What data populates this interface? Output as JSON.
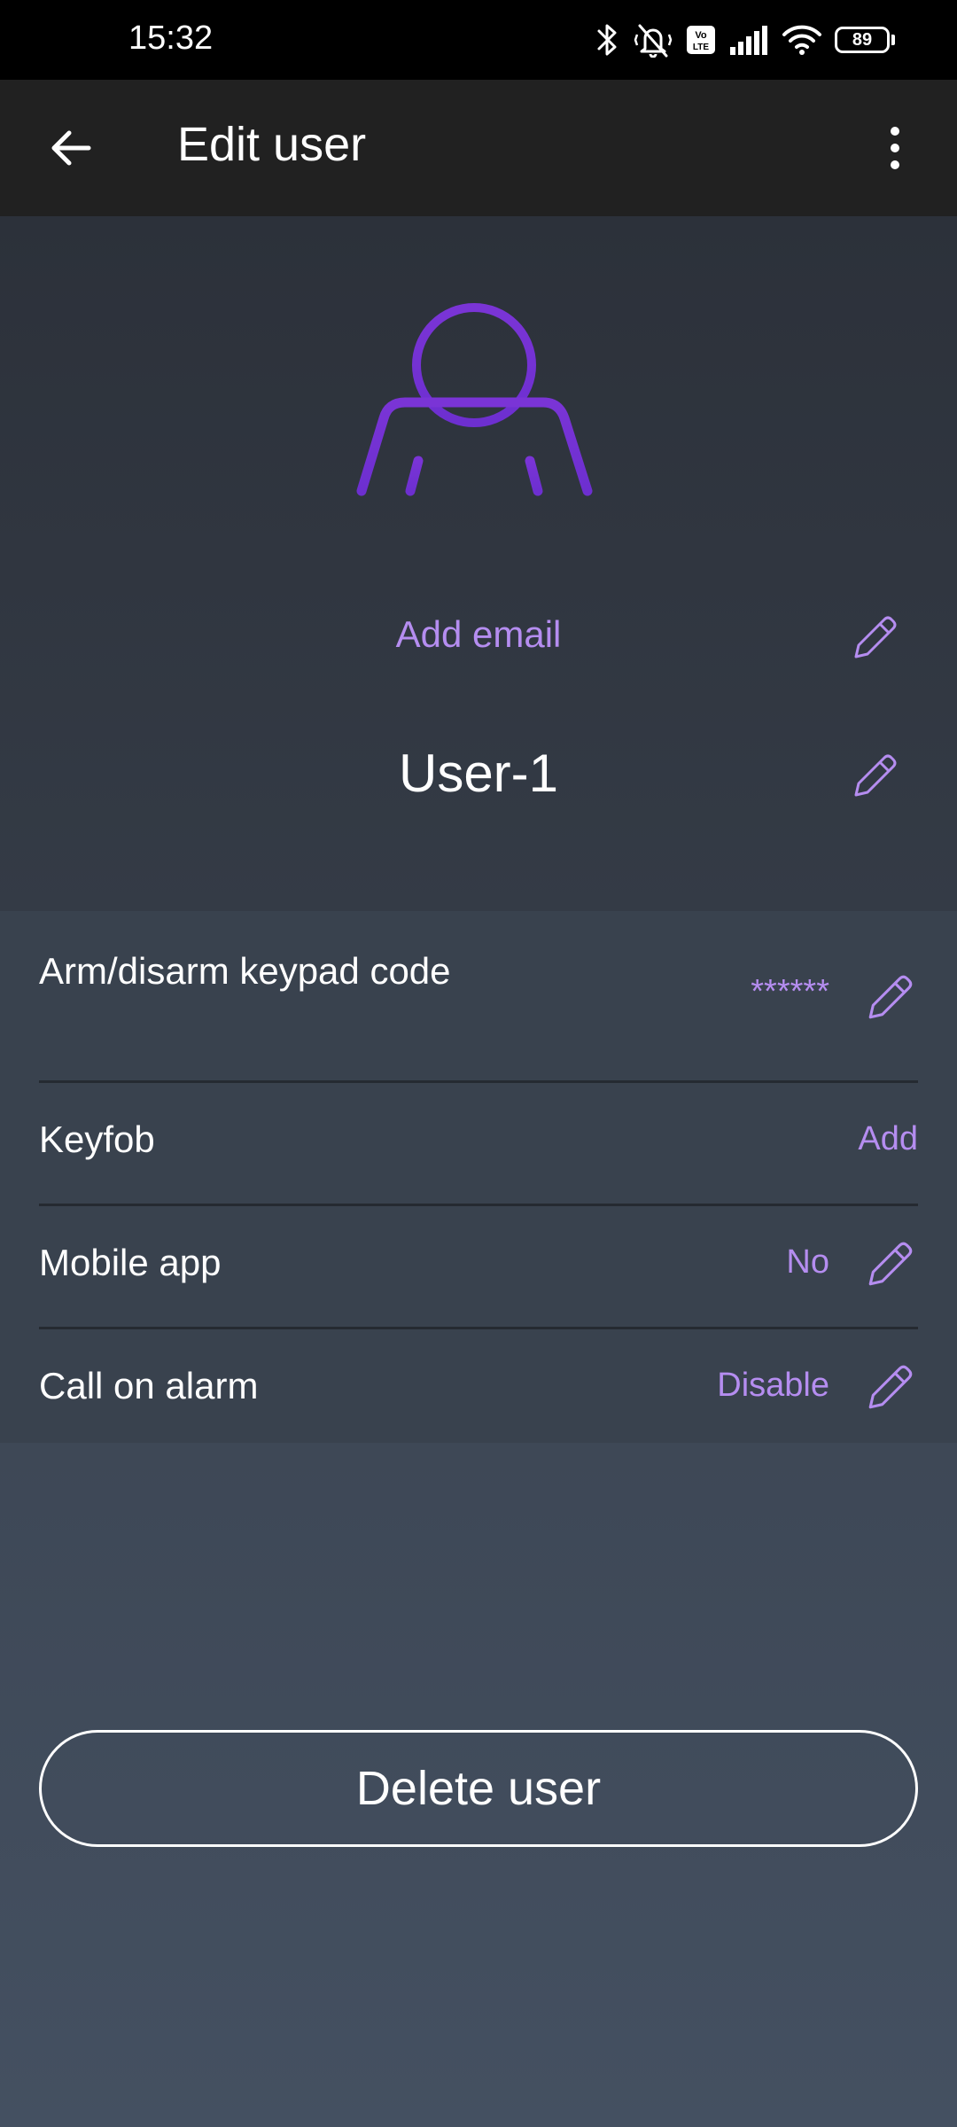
{
  "status_bar": {
    "time": "15:32",
    "battery": "89",
    "icons": [
      "bluetooth-icon",
      "mute-vibrate-icon",
      "volte-icon",
      "signal-icon",
      "wifi-icon",
      "battery-icon"
    ]
  },
  "app_bar": {
    "title": "Edit user",
    "back_icon": "arrow-left-icon",
    "menu_icon": "more-vertical-icon"
  },
  "profile": {
    "email_placeholder": "Add email",
    "name": "User-1",
    "avatar_icon": "user-icon",
    "accent_color": "#b58df0",
    "avatar_color": "#7a34d6"
  },
  "settings": [
    {
      "label": "Arm/disarm keypad code",
      "value": "******",
      "editable": true
    },
    {
      "label": "Keyfob",
      "value": "Add",
      "editable": false
    },
    {
      "label": "Mobile app",
      "value": "No",
      "editable": true
    },
    {
      "label": "Call on alarm",
      "value": "Disable",
      "editable": true
    }
  ],
  "delete_button_label": "Delete user"
}
